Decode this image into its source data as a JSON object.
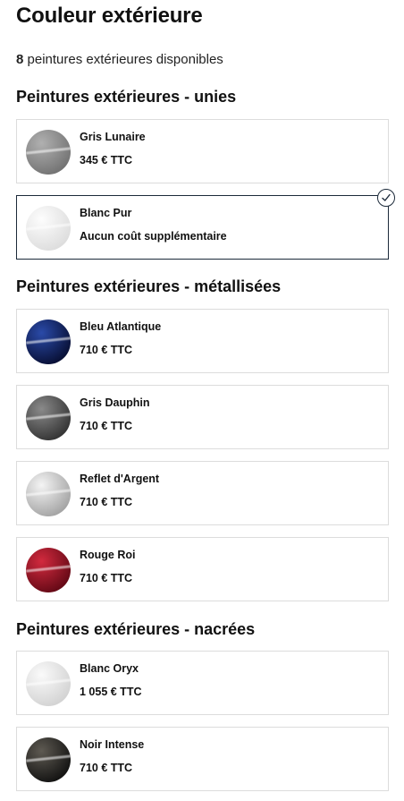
{
  "page": {
    "title": "Couleur extérieure",
    "count_number": "8",
    "count_text": " peintures extérieures disponibles"
  },
  "sections": [
    {
      "title": "Peintures extérieures - unies"
    },
    {
      "title": "Peintures extérieures - métallisées"
    },
    {
      "title": "Peintures extérieures - nacrées"
    }
  ],
  "colors": [
    {
      "name": "Gris Lunaire",
      "price": "345 € TTC",
      "swatch": [
        "#b0b0b0",
        "#6d6d6d"
      ]
    },
    {
      "name": "Blanc Pur",
      "price": "Aucun coût supplémentaire",
      "swatch": [
        "#fdfdfd",
        "#dadada"
      ],
      "selected": true
    },
    {
      "name": "Bleu Atlantique",
      "price": "710 € TTC",
      "swatch": [
        "#2a4aa8",
        "#050a2a"
      ]
    },
    {
      "name": "Gris Dauphin",
      "price": "710 € TTC",
      "swatch": [
        "#8a8a8a",
        "#2c2c2c"
      ]
    },
    {
      "name": "Reflet d'Argent",
      "price": "710 € TTC",
      "swatch": [
        "#f4f4f4",
        "#9c9c9c"
      ]
    },
    {
      "name": "Rouge Roi",
      "price": "710 € TTC",
      "swatch": [
        "#d22a3e",
        "#5a0612"
      ]
    },
    {
      "name": "Blanc Oryx",
      "price": "1 055 € TTC",
      "swatch": [
        "#fafafa",
        "#cfcfcf"
      ]
    },
    {
      "name": "Noir Intense",
      "price": "710 € TTC",
      "swatch": [
        "#5e5a52",
        "#0c0c0c"
      ]
    }
  ],
  "accent": "#1c2a3a"
}
